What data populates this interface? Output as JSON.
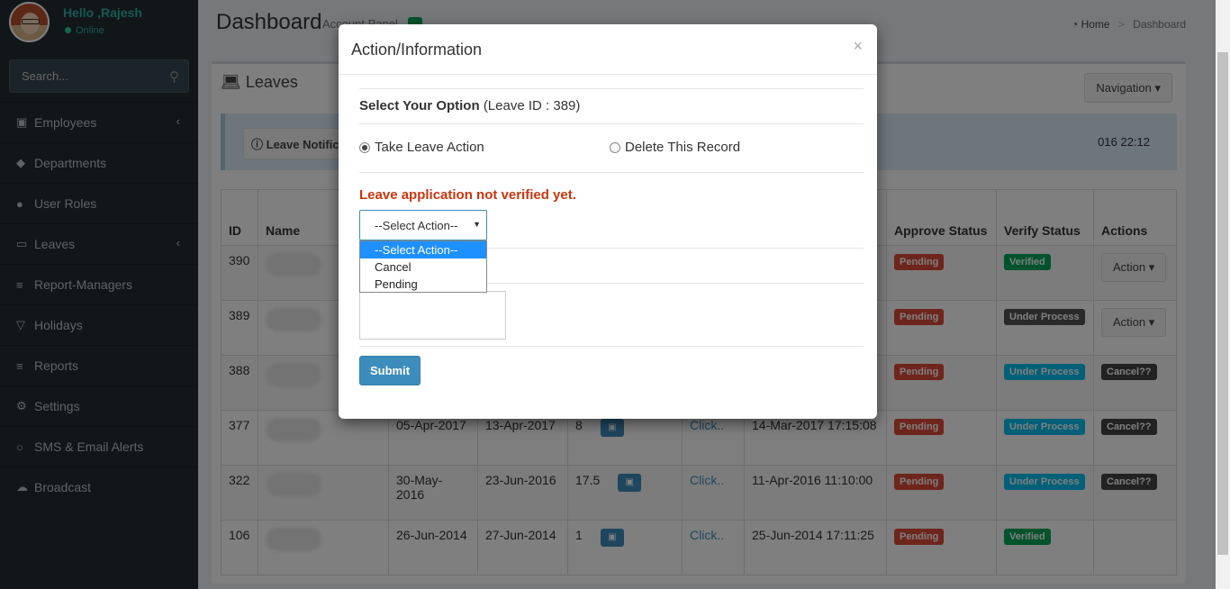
{
  "sidebar": {
    "greeting": "Hello ,Rajesh",
    "status": "Online",
    "search_placeholder": "Search...",
    "items": [
      {
        "label": "Employees",
        "icon": "briefcase-icon",
        "has_arrow": true
      },
      {
        "label": "Departments",
        "icon": "tags-icon",
        "has_arrow": false
      },
      {
        "label": "User Roles",
        "icon": "users-icon",
        "has_arrow": false
      },
      {
        "label": "Leaves",
        "icon": "laptop-icon",
        "has_arrow": true
      },
      {
        "label": "Report-Managers",
        "icon": "list-icon",
        "has_arrow": false
      },
      {
        "label": "Holidays",
        "icon": "glass-icon",
        "has_arrow": false
      },
      {
        "label": "Reports",
        "icon": "list-icon",
        "has_arrow": false
      },
      {
        "label": "Settings",
        "icon": "gear-icon",
        "has_arrow": false
      },
      {
        "label": "SMS & Email Alerts",
        "icon": "pin-icon",
        "has_arrow": false
      },
      {
        "label": "Broadcast",
        "icon": "cloud-icon",
        "has_arrow": false
      }
    ]
  },
  "header": {
    "title": "Dashboard",
    "subtitle": "Account Panel",
    "breadcrumb_home": "Home",
    "breadcrumb_current": "Dashboard"
  },
  "box": {
    "title": "Leaves",
    "navigation": "Navigation",
    "notification_button": "Leave Notifica",
    "notification_time": "016 22:12"
  },
  "table": {
    "headers": [
      "ID",
      "Name",
      "",
      "",
      "",
      "",
      "",
      "Approve Status",
      "Verify Status",
      "Actions"
    ],
    "rows": [
      {
        "id": "390",
        "from": "",
        "to": "",
        "days": "",
        "doc": "",
        "applied": "",
        "approve": "Pending",
        "verify": "Verified",
        "verify_color": "green",
        "action": "Action"
      },
      {
        "id": "389",
        "from": "",
        "to": "",
        "days": "",
        "doc": "",
        "applied": "",
        "approve": "Pending",
        "verify": "Under Process",
        "verify_color": "dark",
        "action": "Action"
      },
      {
        "id": "388",
        "from": "",
        "to": "",
        "days": "",
        "doc": "",
        "applied": "",
        "approve": "Pending",
        "verify": "Under Process",
        "verify_color": "aqua",
        "action": "Cancel??"
      },
      {
        "id": "377",
        "from": "05-Apr-2017",
        "to": "13-Apr-2017",
        "days": "8",
        "doc": "Click..",
        "applied": "14-Mar-2017 17:15:08",
        "approve": "Pending",
        "verify": "Under Process",
        "verify_color": "aqua",
        "action": "Cancel??"
      },
      {
        "id": "322",
        "from": "30-May-2016",
        "to": "23-Jun-2016",
        "days": "17.5",
        "doc": "Click..",
        "applied": "11-Apr-2016 11:10:00",
        "approve": "Pending",
        "verify": "Under Process",
        "verify_color": "aqua",
        "action": "Cancel??"
      },
      {
        "id": "106",
        "from": "26-Jun-2014",
        "to": "27-Jun-2014",
        "days": "1",
        "doc": "Click..",
        "applied": "25-Jun-2014 17:11:25",
        "approve": "Pending",
        "verify": "Verified",
        "verify_color": "green",
        "action": ""
      }
    ]
  },
  "modal": {
    "title": "Action/Information",
    "close": "×",
    "option_title": "Select Your Option",
    "leave_id_text": "(Leave ID : 389)",
    "radio_take": "Take Leave Action",
    "radio_delete": "Delete This Record",
    "warning": "Leave application not verified yet.",
    "select_value": "--Select Action--",
    "select_options": [
      "--Select Action--",
      "Cancel",
      "Pending"
    ],
    "submit": "Submit"
  },
  "colors": {
    "sidebar_bg": "#222d32",
    "accent": "#3c8dbc",
    "pending": "#dd4b39",
    "verified": "#00a65a",
    "under_process": "#00c0ef",
    "warning_text": "#c8360f"
  }
}
